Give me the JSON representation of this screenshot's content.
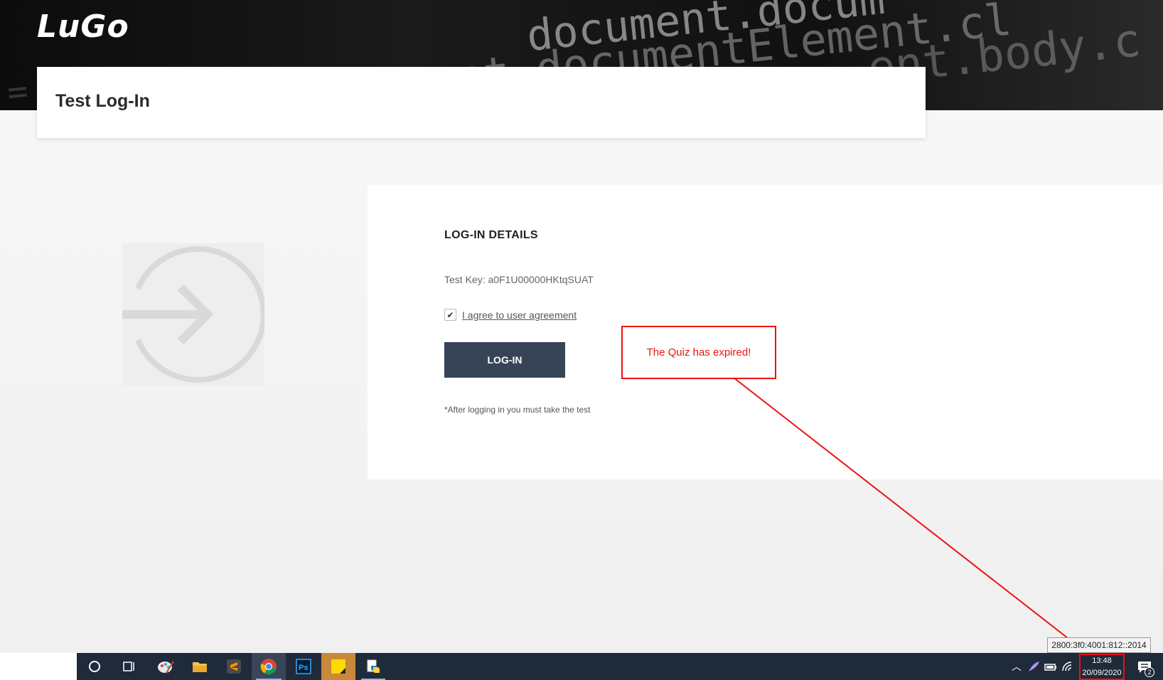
{
  "header": {
    "logo": "LuGo",
    "code_lines": [
      "document.docum",
      "(document.documentElement.cl",
      "ent.body.c",
      "= = #"
    ],
    "page_title": "Test Log-In"
  },
  "login": {
    "section_title": "LOG-IN DETAILS",
    "test_key": "Test Key: a0F1U00000HKtqSUAT",
    "agree_checked": true,
    "agree_label": "I agree to user agreement",
    "login_button": "LOG-IN",
    "note": "*After logging in you must take the test"
  },
  "annotation": {
    "message": "The Quiz has expired!",
    "color": "#ee1111"
  },
  "tooltip": {
    "text": "2800:3f0:4001:812::2014"
  },
  "taskbar": {
    "apps": [
      {
        "name": "cortana-icon"
      },
      {
        "name": "task-view-icon"
      },
      {
        "name": "paint-icon"
      },
      {
        "name": "file-explorer-icon"
      },
      {
        "name": "sublime-text-icon"
      },
      {
        "name": "chrome-icon",
        "active": true
      },
      {
        "name": "photoshop-icon"
      },
      {
        "name": "sticky-notes-icon",
        "highlight": true
      },
      {
        "name": "python-icon"
      }
    ],
    "clock_time": "13:48",
    "clock_date": "20/09/2020",
    "notification_count": "2"
  }
}
